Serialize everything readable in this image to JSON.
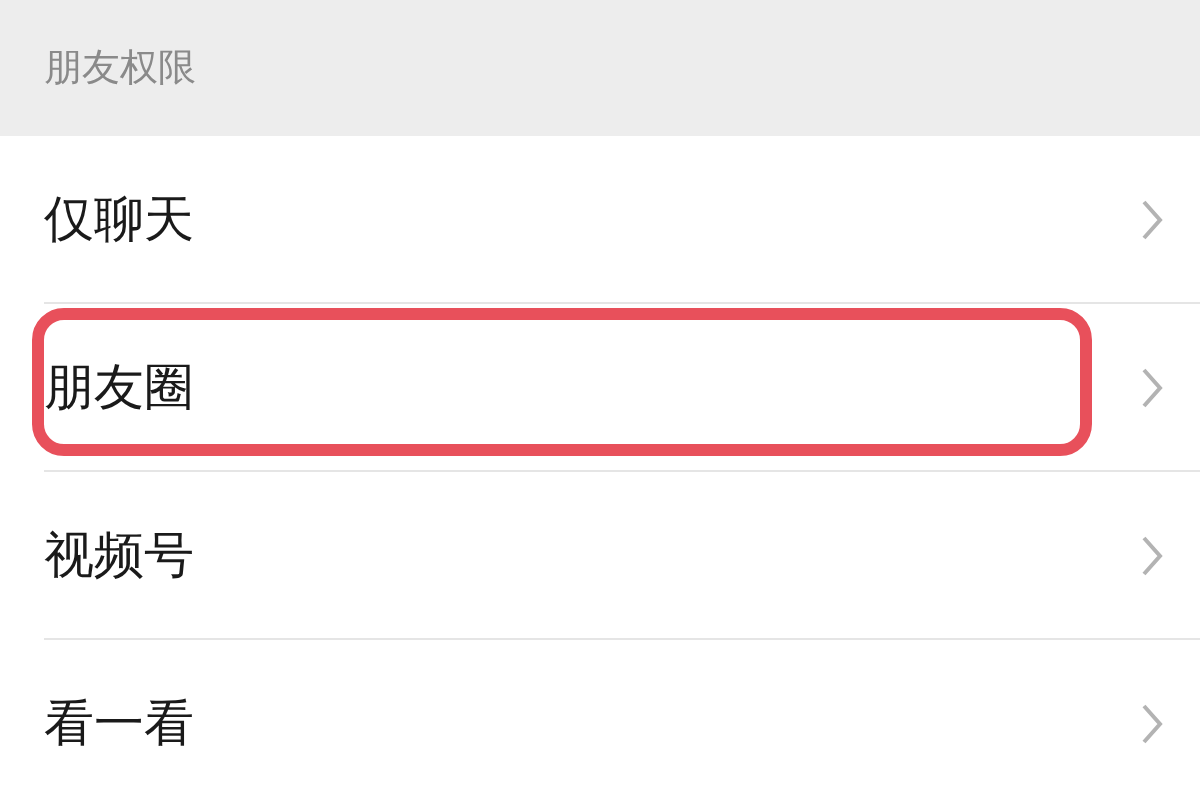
{
  "section": {
    "title": "朋友权限"
  },
  "items": [
    {
      "label": "仅聊天",
      "highlighted": false
    },
    {
      "label": "朋友圈",
      "highlighted": true
    },
    {
      "label": "视频号",
      "highlighted": false
    },
    {
      "label": "看一看",
      "highlighted": false
    }
  ]
}
